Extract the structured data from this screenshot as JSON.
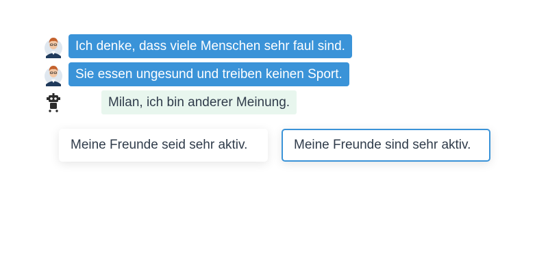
{
  "conversation": {
    "messages": [
      {
        "sender": "user",
        "text": "Ich denke, dass viele Menschen sehr faul sind."
      },
      {
        "sender": "user",
        "text": "Sie essen ungesund und treiben keinen Sport."
      },
      {
        "sender": "bot",
        "text": "Milan, ich bin anderer Meinung."
      }
    ]
  },
  "choices": [
    {
      "text": "Meine Freunde seid sehr aktiv.",
      "selected": false
    },
    {
      "text": "Meine Freunde sind sehr aktiv.",
      "selected": true
    }
  ],
  "colors": {
    "user_bubble": "#3a93d8",
    "bot_bubble": "#e8f6ee",
    "selected_border": "#3a93d8",
    "text": "#2f3b4a"
  },
  "icons": {
    "user_avatar": "user-avatar-icon",
    "bot_avatar": "robot-icon"
  }
}
